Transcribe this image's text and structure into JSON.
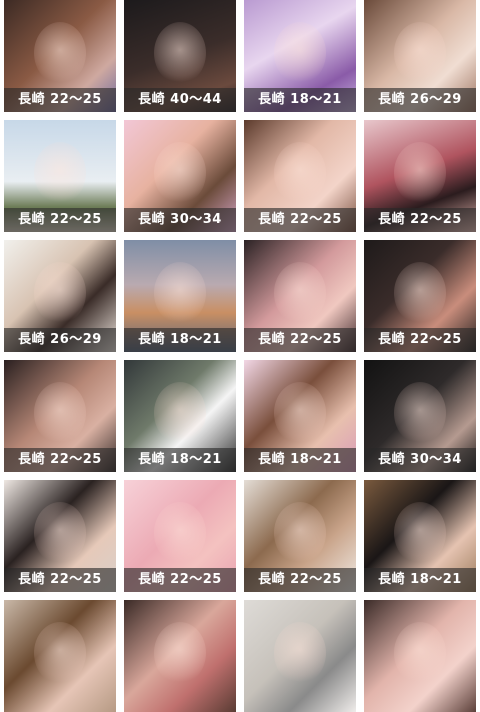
{
  "profiles": [
    {
      "label": "長崎 22〜25",
      "bg": "linear-gradient(135deg,#3c2a24 0%,#8a5a44 45%,#cfa9a0 75%,#6f6a9e 100%)"
    },
    {
      "label": "長崎 40〜44",
      "bg": "linear-gradient(160deg,#1c1a1c 0%,#3b2d2a 50%,#6b4a3e 80%,#2a2224 100%)"
    },
    {
      "label": "長崎 18〜21",
      "bg": "linear-gradient(150deg,#b99ad1 0%,#e8d6ef 40%,#8a5ba8 75%,#c9b3e0 100%)"
    },
    {
      "label": "長崎 26〜29",
      "bg": "linear-gradient(135deg,#6a4a3a 0%,#d9b8a6 45%,#f0ddd2 70%,#9c7360 100%)"
    },
    {
      "label": "長崎 22〜25",
      "bg": "linear-gradient(180deg,#c7d8e8 0%,#e9eef2 55%,#6b7b55 78%,#d8cfbf 100%)"
    },
    {
      "label": "長崎 30〜34",
      "bg": "linear-gradient(135deg,#f2c7d6 0%,#e7b2a0 40%,#6b4b3a 70%,#d5a6c6 100%)"
    },
    {
      "label": "長崎 22〜25",
      "bg": "linear-gradient(135deg,#5b3a2c 0%,#e2b8a7 40%,#f3d4c9 70%,#7a5140 100%)"
    },
    {
      "label": "長崎 22〜25",
      "bg": "linear-gradient(160deg,#e8c7cc 0%,#b0545f 45%,#2b1c1e 70%,#e5b8b0 100%)"
    },
    {
      "label": "長崎 26〜29",
      "bg": "linear-gradient(135deg,#f1f0ec 0%,#d8c3b2 40%,#3a2c28 65%,#efe6df 100%)"
    },
    {
      "label": "長崎 18〜21",
      "bg": "linear-gradient(180deg,#7f8ea6 0%,#b9aab0 40%,#c98f63 65%,#55637a 100%)"
    },
    {
      "label": "長崎 22〜25",
      "bg": "linear-gradient(135deg,#2b2224 0%,#d39a9c 45%,#f0c8c0 70%,#402a2c 100%)"
    },
    {
      "label": "長崎 22〜25",
      "bg": "linear-gradient(135deg,#1e1a1a 0%,#3a2c2a 40%,#c98d7c 70%,#24201f 100%)"
    },
    {
      "label": "長崎 22〜25",
      "bg": "linear-gradient(135deg,#2a2020 0%,#b68776 45%,#d9b0a2 70%,#352a28 100%)"
    },
    {
      "label": "長崎 18〜21",
      "bg": "linear-gradient(135deg,#32383a 0%,#6f7a6a 40%,#f5f5f5 62%,#2c2c2c 100%)"
    },
    {
      "label": "長崎 18〜21",
      "bg": "linear-gradient(135deg,#f2d7e6 0%,#7a4f3c 40%,#e8c0ae 70%,#d89ab8 100%)"
    },
    {
      "label": "長崎 30〜34",
      "bg": "linear-gradient(135deg,#121212 0%,#2e2a2a 45%,#b59a90 75%,#1a1818 100%)"
    },
    {
      "label": "長崎 22〜25",
      "bg": "linear-gradient(135deg,#efe8e3 0%,#2a2221 40%,#e6c9b9 70%,#d8d0ca 100%)"
    },
    {
      "label": "長崎 22〜25",
      "bg": "linear-gradient(135deg,#f7d1d8 0%,#ecaab4 45%,#f4c2c0 70%,#e8a2b0 100%)"
    },
    {
      "label": "長崎 22〜25",
      "bg": "linear-gradient(135deg,#e4ddd6 0%,#8c6a4e 40%,#c9a48a 65%,#f1ece7 100%)"
    },
    {
      "label": "長崎 18〜21",
      "bg": "linear-gradient(135deg,#7a5a3e 0%,#1a1616 40%,#e5c3b1 70%,#9a7a5a 100%)"
    },
    {
      "label": "",
      "bg": "linear-gradient(135deg,#c9b8a8 0%,#6b4a30 40%,#e6c5b6 70%,#b69a84 100%)"
    },
    {
      "label": "",
      "bg": "linear-gradient(135deg,#3a2a26 0%,#d9a79b 45%,#c0706e 70%,#5a3c34 100%)"
    },
    {
      "label": "",
      "bg": "linear-gradient(135deg,#dedbd7 0%,#c6c1ba 45%,#8a8a8a 70%,#efecea 100%)"
    },
    {
      "label": "",
      "bg": "linear-gradient(135deg,#3b2b28 0%,#e2b4ab 45%,#f3d2cb 70%,#5c403a 100%)"
    }
  ]
}
